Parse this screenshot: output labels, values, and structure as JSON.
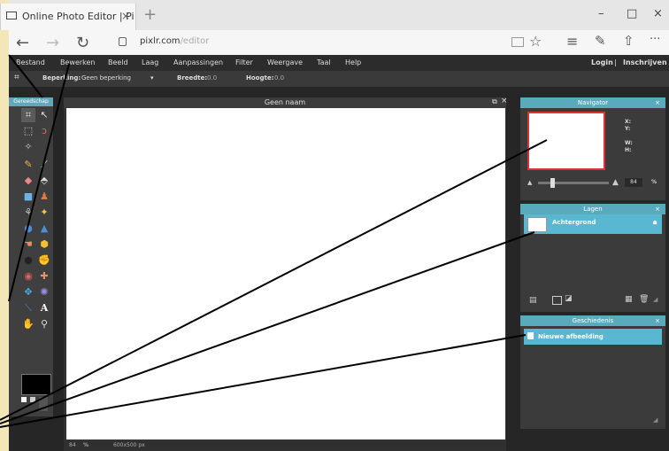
{
  "browser": {
    "tab_title": "Online Photo Editor | Pi",
    "tab_close": "×",
    "new_tab": "+",
    "url_host": "pixlr.com",
    "url_path": "/editor",
    "win_min": "–",
    "win_max": "□",
    "win_close": "×",
    "back": "←",
    "forward": "→",
    "refresh": "↻",
    "more": "···"
  },
  "menu": {
    "items": [
      "Bestand",
      "Bewerken",
      "Beeld",
      "Laag",
      "Aanpassingen",
      "Filter",
      "Weergave",
      "Taal",
      "Help"
    ],
    "login": "Login",
    "separator": "|",
    "register": "Inschrijven"
  },
  "options": {
    "constraint_label": "Beperking:",
    "constraint_value": "Geen beperking",
    "width_label": "Breedte:",
    "width_value": "0.0",
    "height_label": "Hoogte:",
    "height_value": "0.0"
  },
  "toolbox": {
    "title": "Gereedschap"
  },
  "canvas": {
    "title": "Geen naam",
    "zoom": "84",
    "zoom_unit": "%",
    "size": "600x500 px"
  },
  "navigator": {
    "title": "Navigator",
    "x_label": "X:",
    "y_label": "Y:",
    "w_label": "W:",
    "h_label": "H:",
    "zoom": "84",
    "zoom_unit": "%"
  },
  "layers": {
    "title": "Lagen",
    "items": [
      "Achtergrond"
    ]
  },
  "history": {
    "title": "Geschiedenis",
    "items": [
      "Nieuwe afbeelding"
    ]
  },
  "colors": {
    "accent": "#5ab7d1",
    "app_bg": "#262626",
    "annotation_bg": "#f4e7b7"
  }
}
